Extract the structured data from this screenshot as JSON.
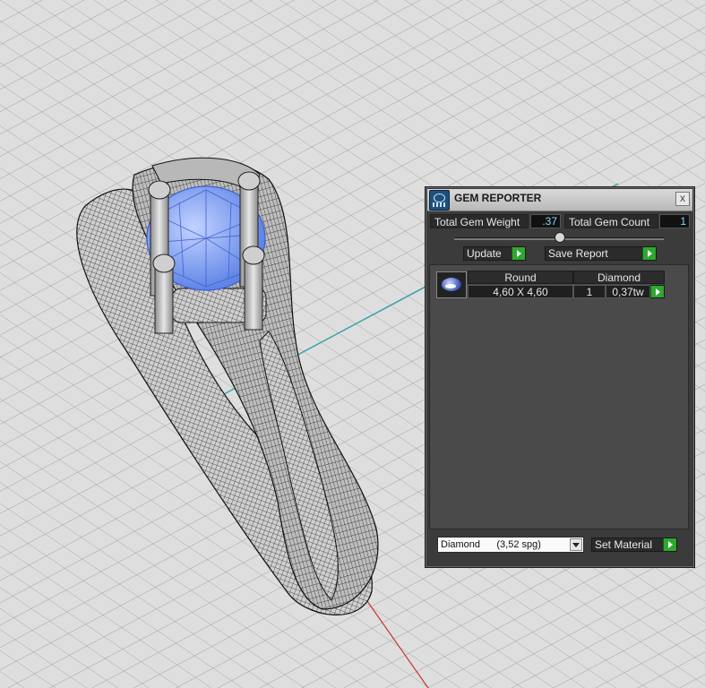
{
  "panel": {
    "title": "GEM REPORTER",
    "close_glyph": "x",
    "total_weight_label": "Total Gem Weight",
    "total_weight_value": ".37",
    "total_count_label": "Total Gem Count",
    "total_count_value": "1",
    "update_label": "Update",
    "save_report_label": "Save Report",
    "table": {
      "headers": [
        "Round",
        "Diamond"
      ],
      "row": {
        "size": "4,60 X 4,60",
        "count": "1",
        "weight": "0,37tw"
      }
    },
    "material_select": {
      "value": "Diamond      (3,52 spg)"
    },
    "set_material_label": "Set Material"
  },
  "colors": {
    "panel_bg": "#3b3b3b",
    "accent_green": "#2fa82f",
    "value_text": "#7fd8ff",
    "grid_bg": "#dcdcdc",
    "gem_blue": "#6f95ec"
  },
  "icons": {
    "app": "gem-reporter-icon",
    "close": "close-icon",
    "arrow": "play-arrow-icon",
    "dropdown": "chevron-down-icon"
  }
}
